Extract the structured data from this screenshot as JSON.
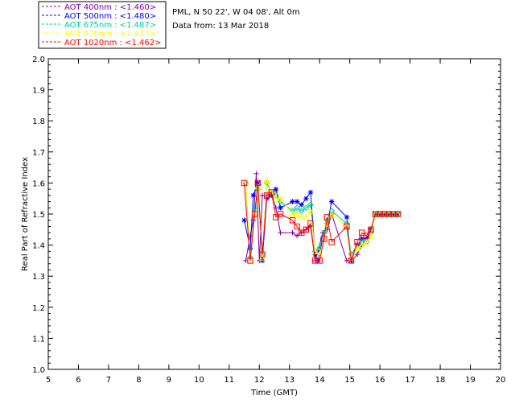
{
  "chart_data": {
    "type": "line",
    "header": {
      "site": "PML, N 50 22', W 04 08', Alt 0m",
      "date": "Data from: 13 Mar 2018"
    },
    "xlabel": "Time (GMT)",
    "ylabel": "Real Part of Refractive Index",
    "xlim": [
      5,
      20
    ],
    "ylim": [
      1.0,
      2.0
    ],
    "x_ticks": [
      5,
      6,
      7,
      8,
      9,
      10,
      11,
      12,
      13,
      14,
      15,
      16,
      17,
      18,
      19,
      20
    ],
    "y_ticks": [
      1.0,
      1.1,
      1.2,
      1.3,
      1.4,
      1.5,
      1.6,
      1.7,
      1.8,
      1.9,
      2.0
    ],
    "legend_position": "top-left, outside plot",
    "grid": false,
    "series": [
      {
        "name": "AOT  400nm : <1.460>",
        "color": "#8000a0",
        "marker": "plus",
        "x": [
          11.55,
          11.7,
          11.8,
          11.9,
          12.0,
          12.1,
          12.25,
          12.4,
          12.55,
          12.7,
          13.1,
          13.25,
          13.4,
          13.55,
          13.7,
          13.85,
          13.95,
          14.1,
          14.25,
          14.4,
          14.9,
          15.05,
          15.25,
          15.4,
          15.55,
          15.7,
          15.85,
          16.0,
          16.15,
          16.3,
          16.45,
          16.6
        ],
        "values": [
          1.35,
          1.43,
          1.48,
          1.63,
          1.35,
          1.56,
          1.56,
          1.57,
          1.52,
          1.44,
          1.44,
          1.43,
          1.44,
          1.45,
          1.46,
          1.35,
          1.38,
          1.44,
          1.45,
          1.5,
          1.35,
          1.35,
          1.37,
          1.4,
          1.42,
          1.45,
          1.5,
          1.5,
          1.5,
          1.5,
          1.5,
          1.5
        ]
      },
      {
        "name": "AOT  500nm : <1.480>",
        "color": "#0000ff",
        "marker": "asterisk",
        "x": [
          11.5,
          11.7,
          11.8,
          11.95,
          12.1,
          12.25,
          12.4,
          12.55,
          12.7,
          13.1,
          13.25,
          13.4,
          13.55,
          13.7,
          13.85,
          13.95,
          14.1,
          14.25,
          14.4,
          14.9,
          15.05,
          15.25,
          15.4,
          15.55,
          15.7,
          15.85,
          16.0,
          16.15,
          16.3,
          16.45,
          16.6
        ],
        "values": [
          1.48,
          1.39,
          1.56,
          1.6,
          1.35,
          1.55,
          1.56,
          1.58,
          1.52,
          1.54,
          1.54,
          1.53,
          1.55,
          1.57,
          1.37,
          1.35,
          1.42,
          1.47,
          1.54,
          1.49,
          1.35,
          1.4,
          1.42,
          1.42,
          1.45,
          1.5,
          1.5,
          1.5,
          1.5,
          1.5,
          1.5
        ]
      },
      {
        "name": "AOT  675nm : <1.487>",
        "color": "#00c8a0",
        "marker": "diamond",
        "x": [
          11.55,
          11.7,
          11.85,
          11.95,
          12.1,
          12.25,
          12.4,
          12.55,
          12.7,
          13.1,
          13.25,
          13.4,
          13.55,
          13.7,
          13.85,
          14.0,
          14.15,
          14.25,
          14.4,
          14.9,
          15.05,
          15.25,
          15.4,
          15.55,
          15.7,
          15.85,
          16.0,
          16.15,
          16.3,
          16.45,
          16.6
        ],
        "values": [
          1.6,
          1.36,
          1.52,
          1.58,
          1.37,
          1.6,
          1.57,
          1.56,
          1.54,
          1.51,
          1.52,
          1.51,
          1.52,
          1.53,
          1.38,
          1.39,
          1.44,
          1.48,
          1.51,
          1.47,
          1.37,
          1.4,
          1.41,
          1.41,
          1.44,
          1.5,
          1.5,
          1.5,
          1.5,
          1.5,
          1.5
        ]
      },
      {
        "name": "AOT  870nm : <1.477>",
        "color": "#ffff00",
        "marker": "triangle",
        "x": [
          11.55,
          11.7,
          11.85,
          11.95,
          12.1,
          12.25,
          12.4,
          12.55,
          12.7,
          13.1,
          13.25,
          13.4,
          13.55,
          13.7,
          13.85,
          14.0,
          14.15,
          14.25,
          14.4,
          14.9,
          15.05,
          15.25,
          15.4,
          15.55,
          15.7,
          15.85,
          16.0,
          16.15,
          16.3,
          16.45,
          16.6
        ],
        "values": [
          1.6,
          1.35,
          1.5,
          1.59,
          1.36,
          1.61,
          1.57,
          1.55,
          1.55,
          1.5,
          1.5,
          1.49,
          1.49,
          1.51,
          1.38,
          1.37,
          1.42,
          1.47,
          1.5,
          1.46,
          1.36,
          1.39,
          1.4,
          1.41,
          1.43,
          1.5,
          1.5,
          1.5,
          1.5,
          1.5,
          1.5
        ]
      },
      {
        "name": "AOT 1020nm : <1.462>",
        "color": "#ff0000",
        "marker": "square",
        "x": [
          11.5,
          11.7,
          11.85,
          11.95,
          12.1,
          12.25,
          12.4,
          12.55,
          12.7,
          13.1,
          13.25,
          13.4,
          13.55,
          13.7,
          13.85,
          14.0,
          14.15,
          14.25,
          14.4,
          14.9,
          15.05,
          15.25,
          15.4,
          15.55,
          15.7,
          15.85,
          16.0,
          16.15,
          16.3,
          16.45,
          16.6
        ],
        "values": [
          1.6,
          1.35,
          1.5,
          1.6,
          1.37,
          1.56,
          1.57,
          1.49,
          1.5,
          1.48,
          1.46,
          1.44,
          1.45,
          1.47,
          1.35,
          1.35,
          1.42,
          1.49,
          1.41,
          1.46,
          1.35,
          1.41,
          1.44,
          1.43,
          1.45,
          1.5,
          1.5,
          1.5,
          1.5,
          1.5,
          1.5
        ]
      }
    ]
  }
}
